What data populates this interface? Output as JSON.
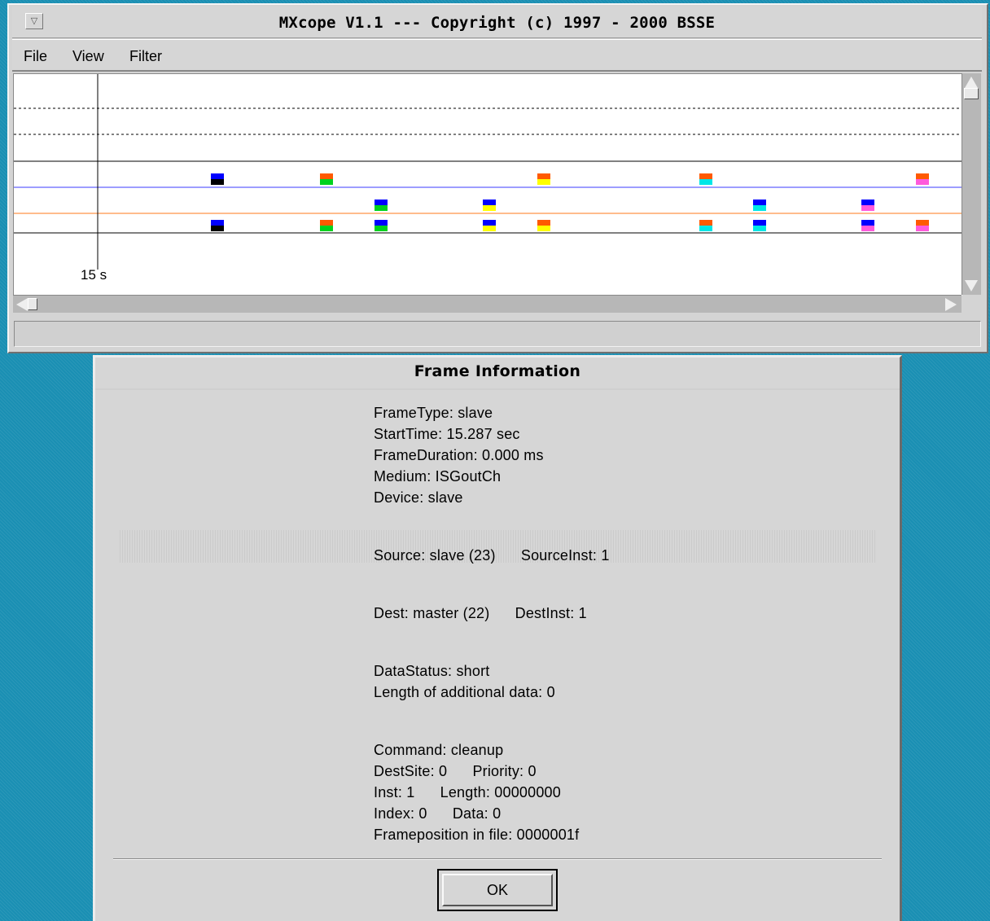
{
  "window": {
    "title": "MXcope V1.1 --- Copyright (c) 1997 - 2000 BSSE",
    "menu_button_glyph": "▽"
  },
  "menu": {
    "items": [
      "File",
      "View",
      "Filter"
    ]
  },
  "timeline": {
    "cursor_label": "15 s",
    "colors": {
      "blue": "#0000ff",
      "black": "#000000",
      "orange": "#ff5a00",
      "green": "#00d21e",
      "yellow": "#ffff00",
      "cyan": "#00e6e6",
      "magenta": "#ff5adc",
      "blue_line": "#3b3bff",
      "orange_line": "#ff7a1a"
    }
  },
  "dialog": {
    "title": "Frame Information",
    "lines": [
      "FrameType: slave",
      "StartTime: 15.287 sec",
      "FrameDuration: 0.000 ms",
      "Medium: ISGoutCh",
      "Device: slave",
      "Source: slave (23)      SourceInst: 1",
      "Dest: master (22)      DestInst: 1",
      "DataStatus: short",
      "Length of additional data: 0",
      "Command: cleanup",
      "DestSite: 0      Priority: 0",
      "Inst: 1      Length: 00000000",
      "Index: 0      Data: 0",
      "Frameposition in file: 0000001f"
    ],
    "ok_label": "OK"
  }
}
